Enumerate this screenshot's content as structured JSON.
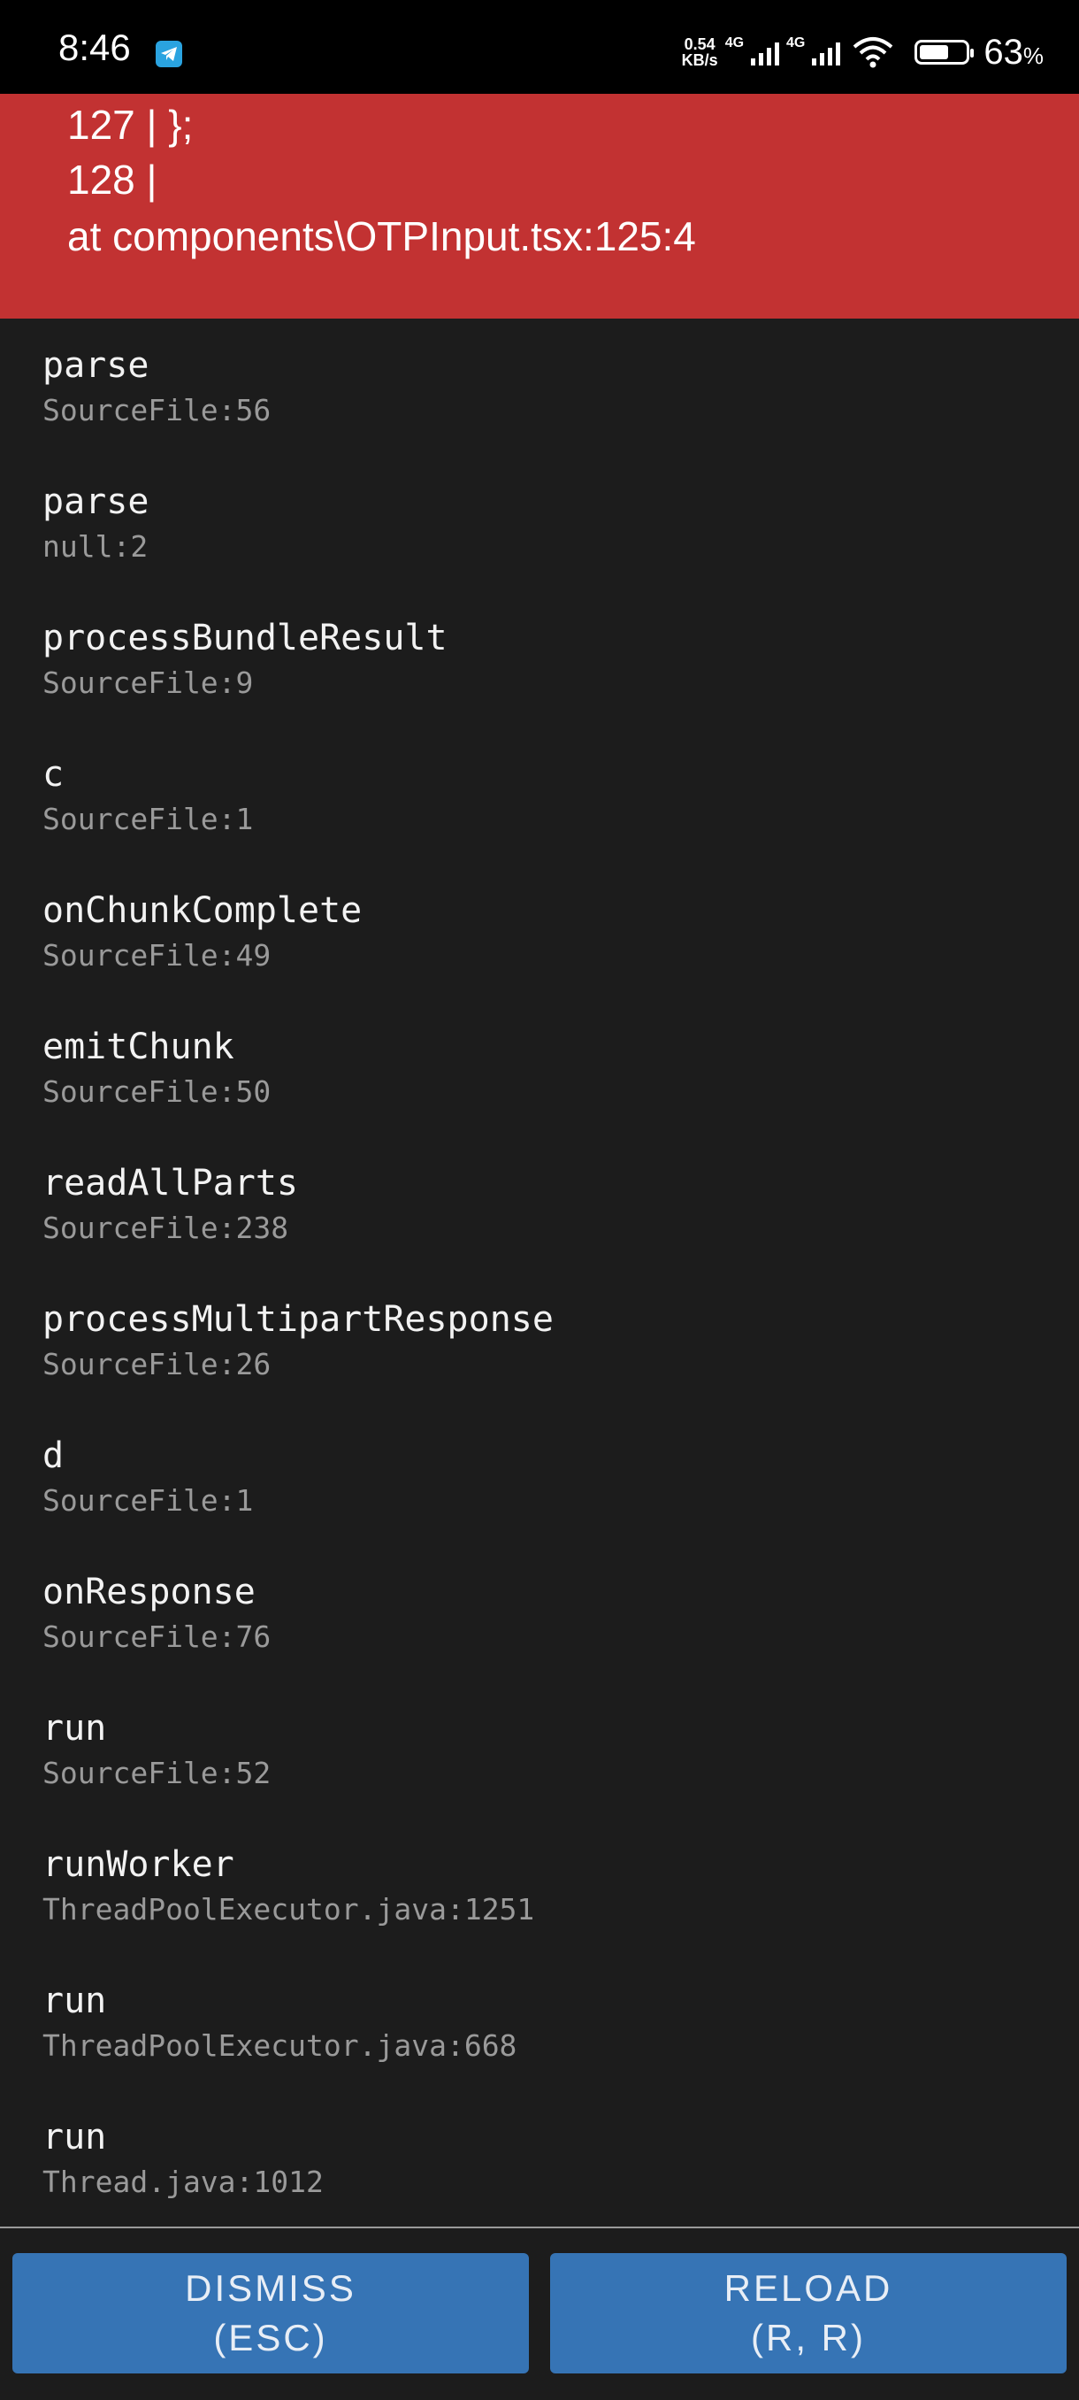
{
  "status_bar": {
    "time": "8:46",
    "net_speed_value": "0.54",
    "net_speed_unit": "KB/s",
    "sim1_tag": "4G",
    "sim2_tag": "4G",
    "battery_percent": "63",
    "battery_unit": "%",
    "battery_level": 0.63
  },
  "error": {
    "lines": [
      "127 | };",
      "128 |",
      "at components\\OTPInput.tsx:125:4"
    ]
  },
  "stack": [
    {
      "name": "parse",
      "loc": "SourceFile:56"
    },
    {
      "name": "parse",
      "loc": "null:2"
    },
    {
      "name": "processBundleResult",
      "loc": "SourceFile:9"
    },
    {
      "name": "c",
      "loc": "SourceFile:1"
    },
    {
      "name": "onChunkComplete",
      "loc": "SourceFile:49"
    },
    {
      "name": "emitChunk",
      "loc": "SourceFile:50"
    },
    {
      "name": "readAllParts",
      "loc": "SourceFile:238"
    },
    {
      "name": "processMultipartResponse",
      "loc": "SourceFile:26"
    },
    {
      "name": "d",
      "loc": "SourceFile:1"
    },
    {
      "name": "onResponse",
      "loc": "SourceFile:76"
    },
    {
      "name": "run",
      "loc": "SourceFile:52"
    },
    {
      "name": "runWorker",
      "loc": "ThreadPoolExecutor.java:1251"
    },
    {
      "name": "run",
      "loc": "ThreadPoolExecutor.java:668"
    },
    {
      "name": "run",
      "loc": "Thread.java:1012"
    }
  ],
  "buttons": {
    "dismiss_label": "DISMISS",
    "dismiss_shortcut": "(ESC)",
    "reload_label": "RELOAD",
    "reload_shortcut": "(R, R)"
  },
  "colors": {
    "error_bg": "#c23232",
    "body_bg": "#1c1c1c",
    "button_bg": "#3674b5"
  }
}
